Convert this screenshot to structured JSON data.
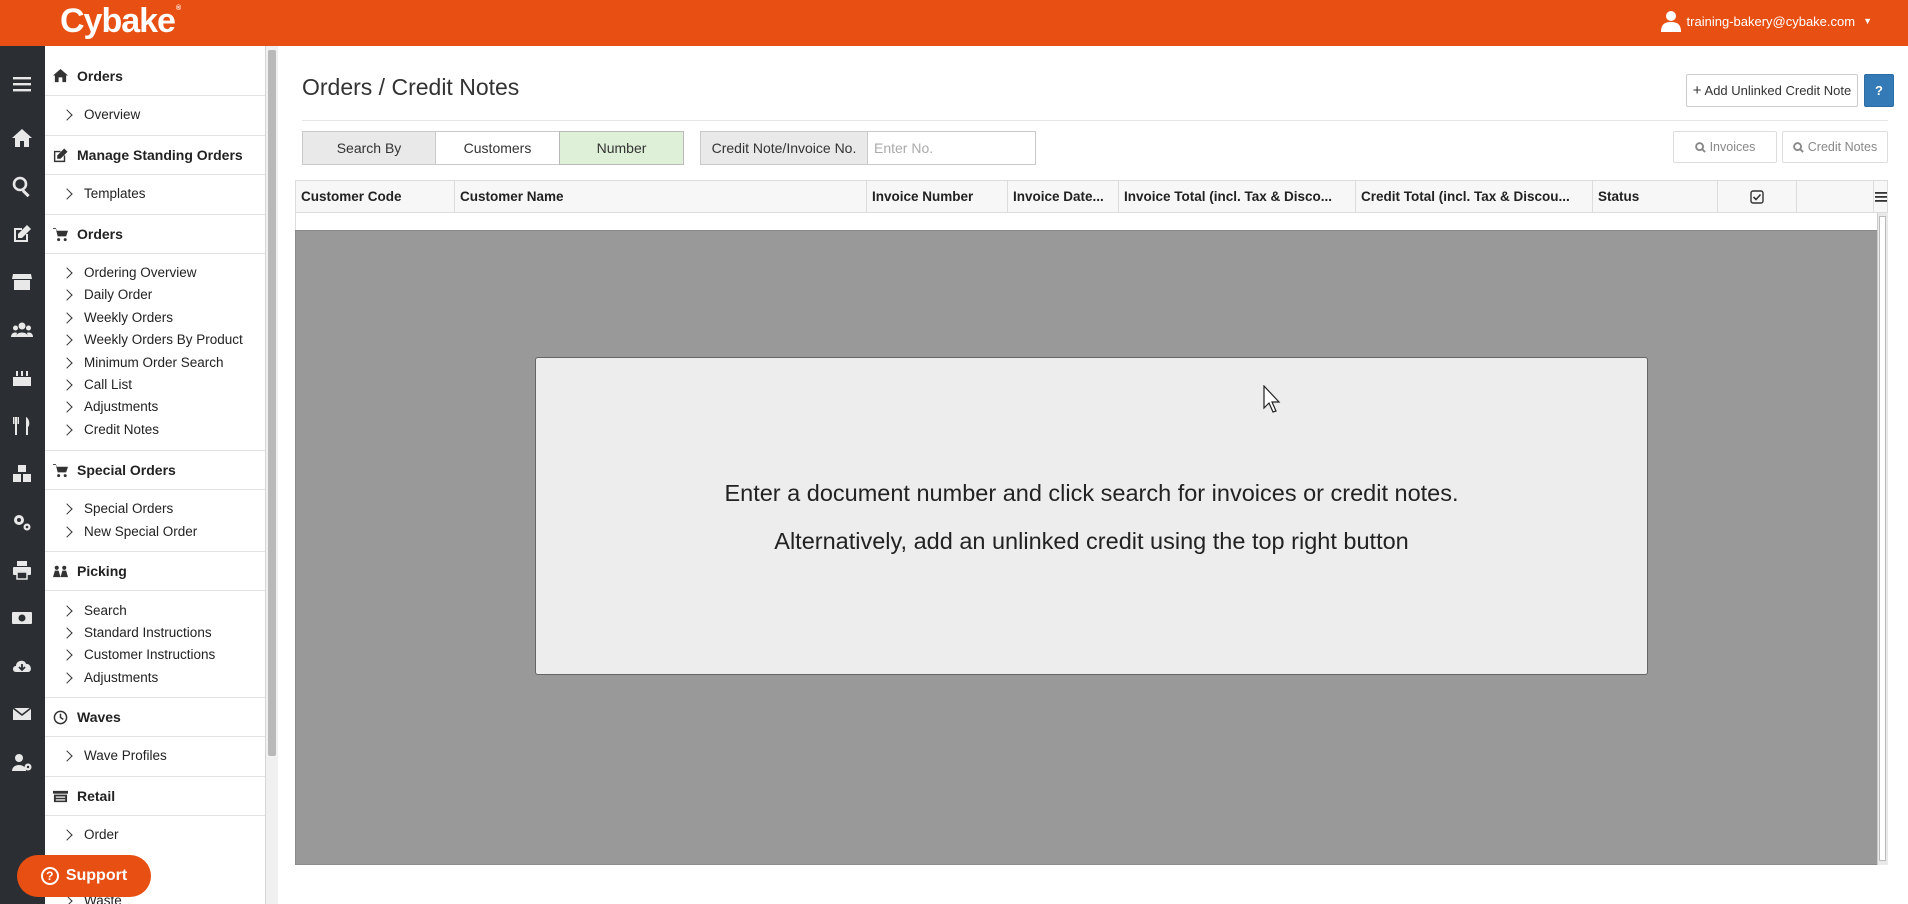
{
  "brand": {
    "name": "Cybake",
    "mark": "®",
    "accent": "#e84f12"
  },
  "user": {
    "email": "training-bakery@cybake.com"
  },
  "sidebar": {
    "sections": [
      {
        "title": "Orders",
        "icon": "home-icon",
        "items": [
          "Overview"
        ]
      },
      {
        "title": "Manage Standing Orders",
        "icon": "edit-icon",
        "items": [
          "Templates"
        ]
      },
      {
        "title": "Orders",
        "icon": "cart-icon",
        "items": [
          "Ordering Overview",
          "Daily Order",
          "Weekly Orders",
          "Weekly Orders By Product",
          "Minimum Order Search",
          "Call List",
          "Adjustments",
          "Credit Notes"
        ]
      },
      {
        "title": "Special Orders",
        "icon": "cart-icon",
        "items": [
          "Special Orders",
          "New Special Order"
        ]
      },
      {
        "title": "Picking",
        "icon": "people-icon",
        "items": [
          "Search",
          "Standard Instructions",
          "Customer Instructions",
          "Adjustments"
        ]
      },
      {
        "title": "Waves",
        "icon": "clock-icon",
        "items": [
          "Wave Profiles"
        ]
      },
      {
        "title": "Retail",
        "icon": "store-icon",
        "items": [
          "Order",
          "Waste"
        ]
      }
    ]
  },
  "page": {
    "title": "Orders / Credit Notes"
  },
  "toolbar": {
    "add_unlinked": "Add Unlinked Credit Note",
    "help": "?",
    "search_by": "Search By",
    "customers": "Customers",
    "number": "Number",
    "field_label": "Credit Note/Invoice No.",
    "field_placeholder": "Enter No.",
    "invoices_btn": "Invoices",
    "credit_notes_btn": "Credit Notes"
  },
  "grid": {
    "columns": [
      "Customer Code",
      "Customer Name",
      "Invoice Number",
      "Invoice Date...",
      "Invoice Total (incl. Tax & Disco...",
      "Credit Total (incl. Tax & Discou...",
      "Status"
    ],
    "message_line1": "Enter a document number and click search for invoices or credit notes.",
    "message_line2": "Alternatively, add an unlinked credit using the top right button"
  },
  "support": {
    "label": "Support"
  }
}
